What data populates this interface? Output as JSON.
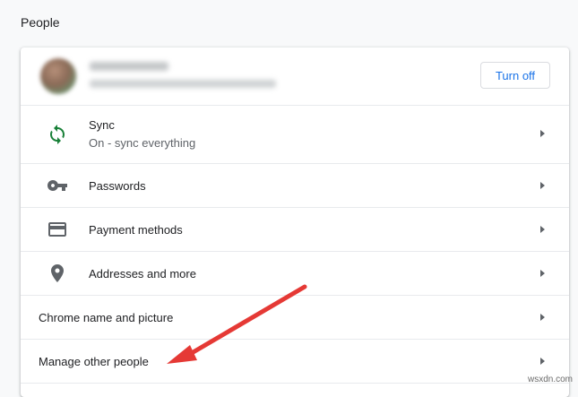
{
  "section": {
    "title": "People"
  },
  "profile": {
    "turn_off_label": "Turn off"
  },
  "rows": [
    {
      "label": "Sync",
      "sub": "On - sync everything",
      "icon": "sync-icon"
    },
    {
      "label": "Passwords",
      "icon": "key-icon"
    },
    {
      "label": "Payment methods",
      "icon": "credit-card-icon"
    },
    {
      "label": "Addresses and more",
      "icon": "location-pin-icon"
    },
    {
      "label": "Chrome name and picture"
    },
    {
      "label": "Manage other people"
    }
  ],
  "colors": {
    "accent": "#1a73e8",
    "sync_green": "#188038",
    "annotation_arrow": "#e53935"
  },
  "watermark": "wsxdn.com"
}
